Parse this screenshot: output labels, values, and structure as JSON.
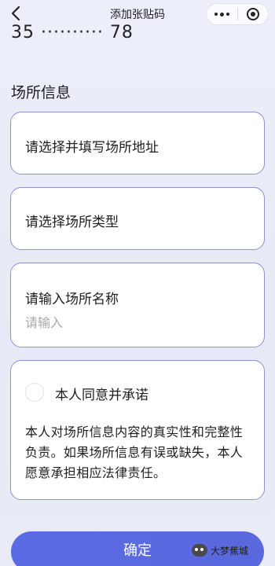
{
  "nav": {
    "title": "添加张贴码"
  },
  "header": {
    "masked_number": "35 ·········· 78"
  },
  "section": {
    "title": "场所信息"
  },
  "form": {
    "address_label": "请选择并填写场所地址",
    "type_label": "请选择场所类型",
    "name_label": "请输入场所名称",
    "name_placeholder": "请输入"
  },
  "agreement": {
    "title": "本人同意并承诺",
    "text": "本人对场所信息内容的真实性和完整性负责。如果场所信息有误或缺失，本人愿意承担相应法律责任。"
  },
  "actions": {
    "confirm_label": "确定"
  },
  "watermark": {
    "text": "大梦蕉城"
  },
  "colors": {
    "accent": "#5b6be4",
    "card_border": "#8c93cf",
    "background": "#e9ebf6"
  }
}
